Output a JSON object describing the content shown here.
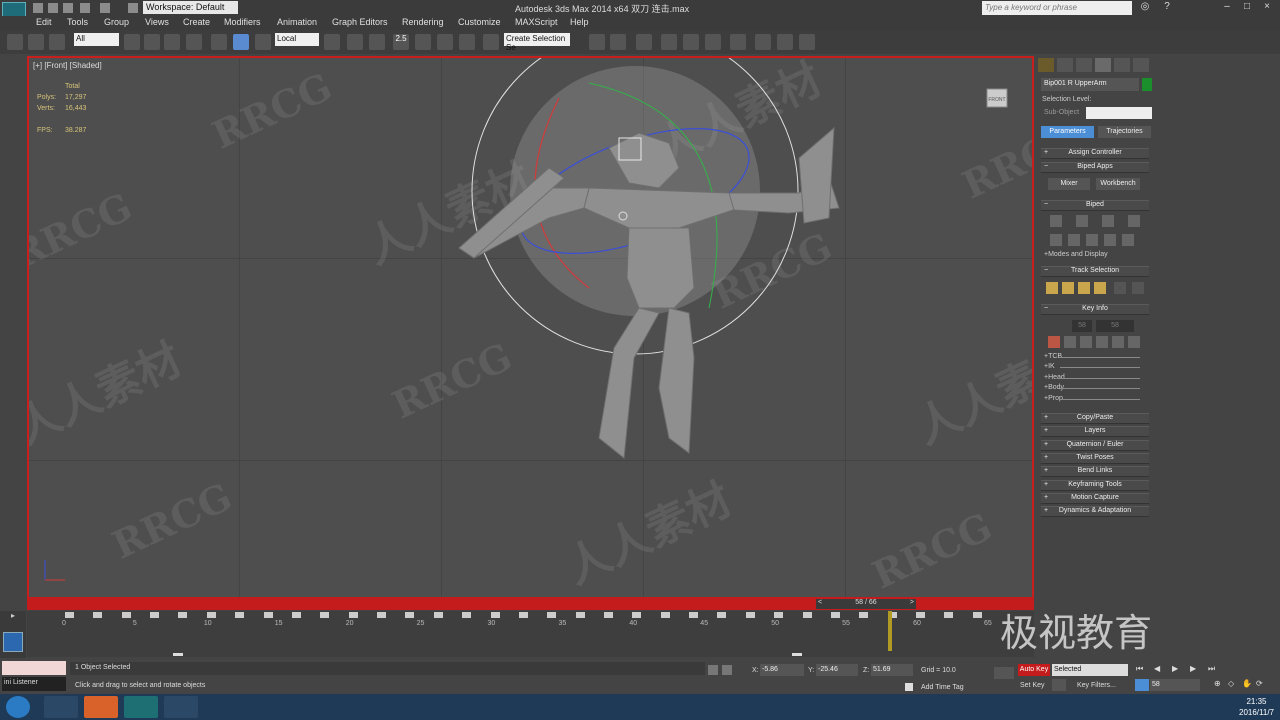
{
  "title_bar": {
    "workspace": "Workspace: Default",
    "title": "Autodesk 3ds Max  2014 x64     双刀 连击.max",
    "search_placeholder": "Type a keyword or phrase"
  },
  "menu": [
    "Edit",
    "Tools",
    "Group",
    "Views",
    "Create",
    "Modifiers",
    "Animation",
    "Graph Editors",
    "Rendering",
    "Customize",
    "MAXScript",
    "Help"
  ],
  "toolbar": {
    "selection_filter": "All",
    "reference_coord": "Local",
    "snap_label": "2.5",
    "named_selection": "Create Selection Se"
  },
  "viewport": {
    "label": "[+] [Front] [Shaded]",
    "viewcube_label": "FRONT",
    "stats": [
      {
        "label": "",
        "value": "Total"
      },
      {
        "label": "Polys:",
        "value": "17,297"
      },
      {
        "label": "Verts:",
        "value": "16,443"
      },
      {
        "label": "FPS:",
        "value": "38.287"
      }
    ]
  },
  "watermarks": [
    "RRCG",
    "人人素材",
    "RRCG",
    "人人素材",
    "RRCG",
    "人人素材",
    "RRCG",
    "人人素材",
    "RRCG",
    "人人素材",
    "RRCG",
    "RRCG"
  ],
  "command_panel": {
    "object_name": "Bip001 R UpperArm",
    "selection_level_label": "Selection Level:",
    "sub_object_label": "Sub-Object",
    "tabs": [
      "Parameters",
      "Trajectories"
    ],
    "rollouts_top": [
      {
        "label": "Assign Controller"
      },
      {
        "label": "Biped Apps"
      }
    ],
    "biped_apps_buttons": [
      "Mixer",
      "Workbench"
    ],
    "biped_label": "Biped",
    "modes_display": "+Modes and Display",
    "track_selection_label": "Track Selection",
    "key_info_label": "Key Info",
    "key_info_values": [
      "58",
      "58"
    ],
    "key_info_rows": [
      "+TCB",
      "+IK",
      "+Head",
      "+Body",
      "+Prop"
    ],
    "rollouts_bottom": [
      "Copy/Paste",
      "Layers",
      "Quaternion / Euler",
      "Twist Poses",
      "Bend Links",
      "Keyframing Tools",
      "Motion Capture",
      "Dynamics & Adaptation"
    ]
  },
  "timeline": {
    "slider_label": "58 / 66",
    "current_frame": 58,
    "total_frames": 66,
    "ticks": [
      "0",
      "5",
      "10",
      "15",
      "20",
      "25",
      "30",
      "35",
      "40",
      "45",
      "50",
      "55",
      "60",
      "65"
    ]
  },
  "status": {
    "listener": "ini Listener",
    "selected_text": "1 Object Selected",
    "prompt_text": "Click and drag to select and rotate objects",
    "x_label": "X:",
    "x_value": "-5.86",
    "y_label": "Y:",
    "y_value": "-25.46",
    "z_label": "Z:",
    "z_value": "51.69",
    "grid": "Grid = 10.0",
    "add_time_tag": "Add Time Tag",
    "auto_key": "Auto Key",
    "selected_dropdown": "Selected",
    "set_key": "Set Key",
    "key_filters": "Key Filters...",
    "frame_field": "58"
  },
  "taskbar": {
    "time": "21:35",
    "date": "2016/11/7"
  },
  "brand_overlay": "极视教育",
  "colors": {
    "viewport_border": "#c81e1e",
    "auto_key": "#c41c1c",
    "panel_active": "#4b8ed6",
    "gizmo_circle": "#e0e0e0",
    "stats_text": "#d7c47a"
  }
}
